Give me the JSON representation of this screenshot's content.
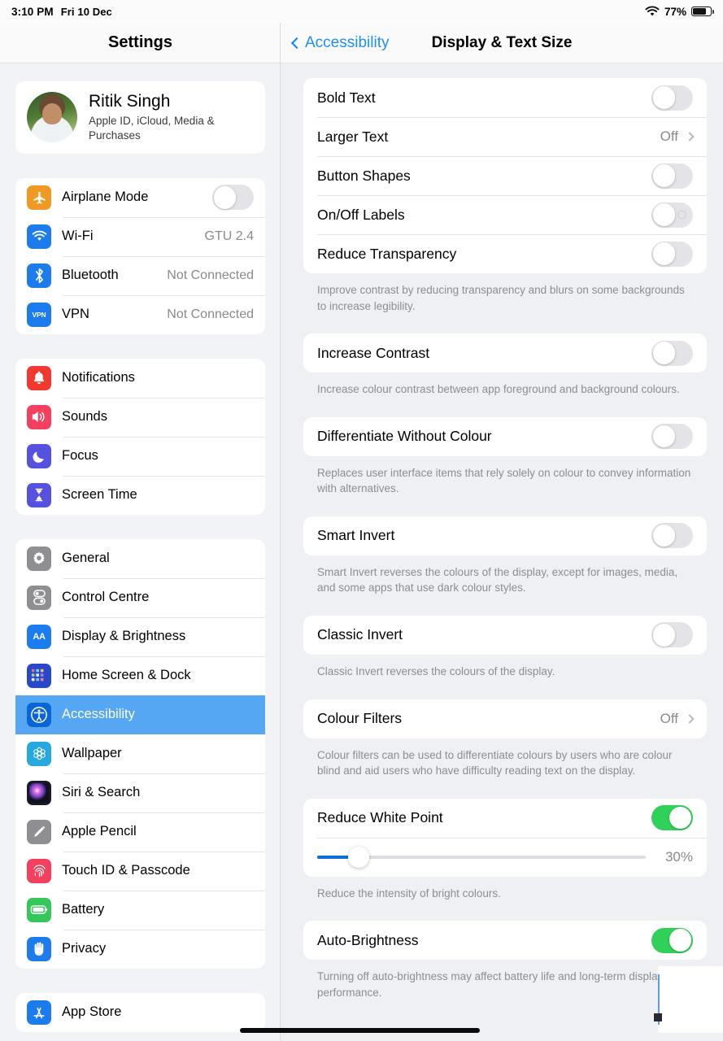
{
  "status_bar": {
    "time": "3:10 PM",
    "date": "Fri 10 Dec",
    "wifi_icon": "wifi-icon",
    "battery_percent": "77%",
    "battery_level": 77
  },
  "sidebar": {
    "title": "Settings",
    "profile": {
      "name": "Ritik Singh",
      "subtitle": "Apple ID, iCloud, Media & Purchases",
      "avatar_name": "avatar"
    },
    "groups": [
      {
        "id": "connectivity",
        "items": [
          {
            "label": "Airplane Mode",
            "icon": "airplane-icon",
            "icon_color": "#f09a24",
            "control": "toggle",
            "value": false
          },
          {
            "label": "Wi-Fi",
            "icon": "wifi-icon",
            "icon_color": "#1c7ced",
            "control": "value",
            "value": "GTU 2.4"
          },
          {
            "label": "Bluetooth",
            "icon": "bluetooth-icon",
            "icon_color": "#1c7ced",
            "control": "value",
            "value": "Not Connected"
          },
          {
            "label": "VPN",
            "icon": "vpn-icon",
            "icon_color": "#1c7ced",
            "control": "value",
            "value": "Not Connected"
          }
        ]
      },
      {
        "id": "alerts",
        "items": [
          {
            "label": "Notifications",
            "icon": "notifications-bell-icon",
            "icon_color": "#f3392f"
          },
          {
            "label": "Sounds",
            "icon": "sounds-speaker-icon",
            "icon_color": "#f43f5e"
          },
          {
            "label": "Focus",
            "icon": "focus-moon-icon",
            "icon_color": "#5552e0"
          },
          {
            "label": "Screen Time",
            "icon": "screen-time-hourglass-icon",
            "icon_color": "#5552e0"
          }
        ]
      },
      {
        "id": "system",
        "items": [
          {
            "label": "General",
            "icon": "gear-icon",
            "icon_color": "#8e8e93"
          },
          {
            "label": "Control Centre",
            "icon": "control-centre-toggles-icon",
            "icon_color": "#8e8e93"
          },
          {
            "label": "Display & Brightness",
            "icon": "display-brightness-aa-icon",
            "icon_color": "#1c7ced"
          },
          {
            "label": "Home Screen & Dock",
            "icon": "home-screen-dock-icon",
            "icon_color": "#2a49c8"
          },
          {
            "label": "Accessibility",
            "icon": "accessibility-icon",
            "icon_color": "#0a66d6",
            "selected": true
          },
          {
            "label": "Wallpaper",
            "icon": "wallpaper-flower-icon",
            "icon_color": "#27a9e0"
          },
          {
            "label": "Siri & Search",
            "icon": "siri-icon",
            "icon_color": "#1a1a28"
          },
          {
            "label": "Apple Pencil",
            "icon": "apple-pencil-icon",
            "icon_color": "#8e8e93"
          },
          {
            "label": "Touch ID & Passcode",
            "icon": "touch-id-fingerprint-icon",
            "icon_color": "#f43f5e"
          },
          {
            "label": "Battery",
            "icon": "battery-icon",
            "icon_color": "#35c759"
          },
          {
            "label": "Privacy",
            "icon": "privacy-hand-icon",
            "icon_color": "#1c7ced"
          }
        ]
      },
      {
        "id": "stores",
        "items": [
          {
            "label": "App Store",
            "icon": "app-store-icon",
            "icon_color": "#1c7ced"
          }
        ]
      }
    ],
    "selected_highlight_color": "#55a6f3"
  },
  "detail": {
    "back_label": "Accessibility",
    "back_icon": "chevron-left-icon",
    "title": "Display & Text Size",
    "sections": [
      {
        "id": "text-section",
        "rows": [
          {
            "label": "Bold Text",
            "control": "toggle",
            "value": false
          },
          {
            "label": "Larger Text",
            "control": "disclosure",
            "value": "Off"
          },
          {
            "label": "Button Shapes",
            "control": "toggle",
            "value": false
          },
          {
            "label": "On/Off Labels",
            "control": "toggle",
            "value": false,
            "off_label_dot": true
          },
          {
            "label": "Reduce Transparency",
            "control": "toggle",
            "value": false
          }
        ],
        "note": "Improve contrast by reducing transparency and blurs on some backgrounds to increase legibility."
      },
      {
        "id": "increase-contrast-section",
        "rows": [
          {
            "label": "Increase Contrast",
            "control": "toggle",
            "value": false
          }
        ],
        "note": "Increase colour contrast between app foreground and background colours."
      },
      {
        "id": "differentiate-section",
        "rows": [
          {
            "label": "Differentiate Without Colour",
            "control": "toggle",
            "value": false
          }
        ],
        "note": "Replaces user interface items that rely solely on colour to convey information with alternatives."
      },
      {
        "id": "smart-invert-section",
        "rows": [
          {
            "label": "Smart Invert",
            "control": "toggle",
            "value": false
          }
        ],
        "note": "Smart Invert reverses the colours of the display, except for images, media, and some apps that use dark colour styles."
      },
      {
        "id": "classic-invert-section",
        "rows": [
          {
            "label": "Classic Invert",
            "control": "toggle",
            "value": false
          }
        ],
        "note": "Classic Invert reverses the colours of the display."
      },
      {
        "id": "colour-filters-section",
        "rows": [
          {
            "label": "Colour Filters",
            "control": "disclosure",
            "value": "Off"
          }
        ],
        "note": "Colour filters can be used to differentiate colours by users who are colour blind and aid users who have difficulty reading text on the display."
      },
      {
        "id": "reduce-white-point-section",
        "rows": [
          {
            "label": "Reduce White Point",
            "control": "toggle",
            "value": true
          },
          {
            "control": "slider",
            "value": "30%",
            "percent": 30
          }
        ],
        "note": "Reduce the intensity of bright colours."
      },
      {
        "id": "auto-brightness-section",
        "rows": [
          {
            "label": "Auto-Brightness",
            "control": "toggle",
            "value": true
          }
        ],
        "note": "Turning off auto-brightness may affect battery life and long-term display performance."
      }
    ]
  },
  "colors": {
    "accent_blue": "#1f8ff0",
    "toggle_on_green": "#30d158",
    "slider_fill_blue": "#0b6fd8",
    "selected_row_blue": "#55a6f3",
    "panel_background": "#eef0f4",
    "card_white": "#ffffff",
    "secondary_text": "#8a8a8e"
  }
}
